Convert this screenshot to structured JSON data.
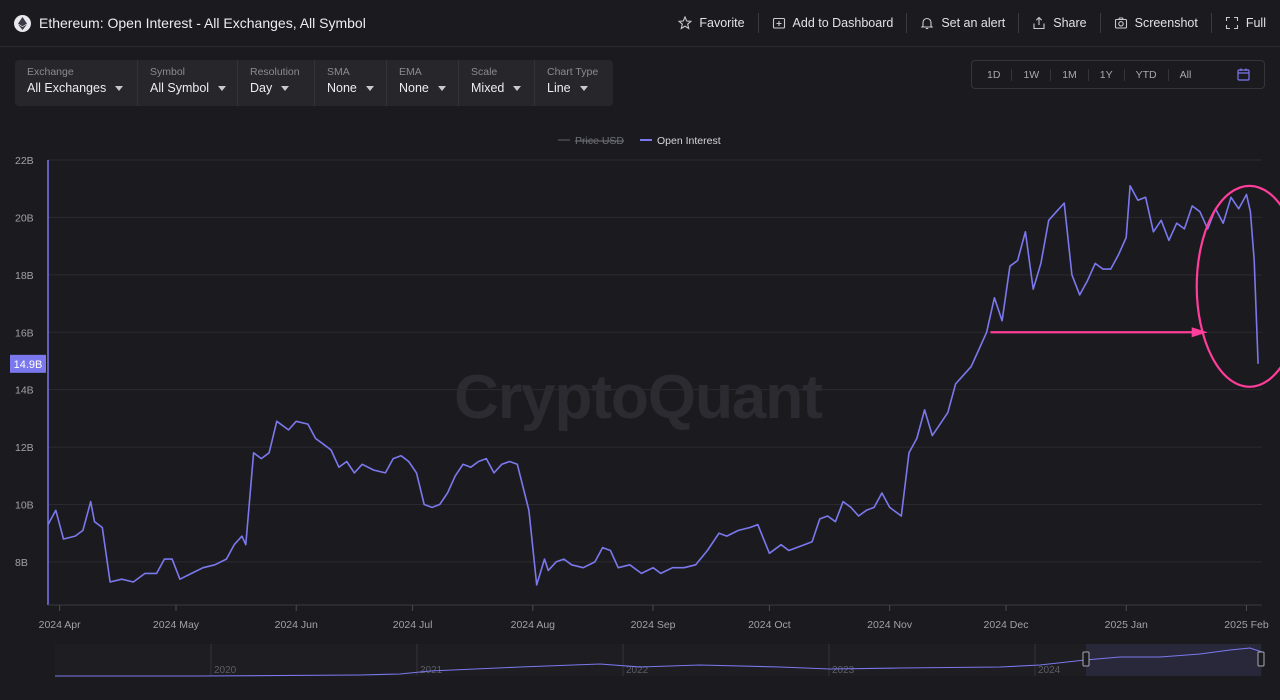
{
  "header": {
    "title": "Ethereum: Open Interest - All Exchanges, All Symbol",
    "actions": {
      "favorite": "Favorite",
      "dashboard": "Add to Dashboard",
      "alert": "Set an alert",
      "share": "Share",
      "screenshot": "Screenshot",
      "full": "Full"
    }
  },
  "controls": [
    {
      "label": "Exchange",
      "value": "All Exchanges"
    },
    {
      "label": "Symbol",
      "value": "All Symbol"
    },
    {
      "label": "Resolution",
      "value": "Day"
    },
    {
      "label": "SMA",
      "value": "None"
    },
    {
      "label": "EMA",
      "value": "None"
    },
    {
      "label": "Scale",
      "value": "Mixed"
    },
    {
      "label": "Chart Type",
      "value": "Line"
    }
  ],
  "ranges": [
    "1D",
    "1W",
    "1M",
    "1Y",
    "YTD",
    "All"
  ],
  "colors": {
    "line": "#7b78ee",
    "annotation": "#ff3d9a",
    "grid": "#2a2a30",
    "axis_text": "#a0a0a8",
    "background": "#1b1b1f",
    "watermark": "#2b2b31"
  },
  "watermark": "CryptoQuant",
  "navigator_years": [
    "2020",
    "2021",
    "2022",
    "2023",
    "2024"
  ],
  "chart_data": {
    "type": "line",
    "legend": [
      {
        "name": "Price USD",
        "hidden": true
      },
      {
        "name": "Open Interest",
        "hidden": false
      }
    ],
    "legend_position": "top-center",
    "y_ticks": [
      "8B",
      "10B",
      "12B",
      "14B",
      "16B",
      "18B",
      "20B",
      "22B"
    ],
    "ylim": [
      6.5,
      22
    ],
    "current_value_label": "14.9B",
    "current_value": 14.9,
    "x_ticks": [
      "2024 Apr",
      "2024 May",
      "2024 Jun",
      "2024 Jul",
      "2024 Aug",
      "2024 Sep",
      "2024 Oct",
      "2024 Nov",
      "2024 Dec",
      "2025 Jan",
      "2025 Feb"
    ],
    "x_tick_dates": [
      "2024-04-01",
      "2024-05-01",
      "2024-06-01",
      "2024-07-01",
      "2024-08-01",
      "2024-09-01",
      "2024-10-01",
      "2024-11-01",
      "2024-12-01",
      "2025-01-01",
      "2025-02-01"
    ],
    "xlim": [
      "2024-03-29",
      "2025-02-05"
    ],
    "grid": true,
    "series": [
      {
        "name": "Open Interest",
        "points": [
          [
            "2024-03-29",
            9.3
          ],
          [
            "2024-03-31",
            9.8
          ],
          [
            "2024-04-02",
            8.8
          ],
          [
            "2024-04-05",
            8.9
          ],
          [
            "2024-04-07",
            9.1
          ],
          [
            "2024-04-09",
            10.1
          ],
          [
            "2024-04-10",
            9.4
          ],
          [
            "2024-04-12",
            9.2
          ],
          [
            "2024-04-14",
            7.3
          ],
          [
            "2024-04-17",
            7.4
          ],
          [
            "2024-04-20",
            7.3
          ],
          [
            "2024-04-23",
            7.6
          ],
          [
            "2024-04-26",
            7.6
          ],
          [
            "2024-04-28",
            8.1
          ],
          [
            "2024-04-30",
            8.1
          ],
          [
            "2024-05-02",
            7.4
          ],
          [
            "2024-05-05",
            7.6
          ],
          [
            "2024-05-08",
            7.8
          ],
          [
            "2024-05-11",
            7.9
          ],
          [
            "2024-05-14",
            8.1
          ],
          [
            "2024-05-16",
            8.6
          ],
          [
            "2024-05-18",
            8.9
          ],
          [
            "2024-05-19",
            8.6
          ],
          [
            "2024-05-21",
            11.8
          ],
          [
            "2024-05-23",
            11.6
          ],
          [
            "2024-05-25",
            11.8
          ],
          [
            "2024-05-27",
            12.9
          ],
          [
            "2024-05-30",
            12.6
          ],
          [
            "2024-06-01",
            12.9
          ],
          [
            "2024-06-04",
            12.8
          ],
          [
            "2024-06-06",
            12.3
          ],
          [
            "2024-06-08",
            12.1
          ],
          [
            "2024-06-10",
            11.9
          ],
          [
            "2024-06-12",
            11.3
          ],
          [
            "2024-06-14",
            11.5
          ],
          [
            "2024-06-16",
            11.1
          ],
          [
            "2024-06-18",
            11.4
          ],
          [
            "2024-06-21",
            11.2
          ],
          [
            "2024-06-24",
            11.1
          ],
          [
            "2024-06-26",
            11.6
          ],
          [
            "2024-06-28",
            11.7
          ],
          [
            "2024-06-30",
            11.5
          ],
          [
            "2024-07-02",
            11.1
          ],
          [
            "2024-07-04",
            10.0
          ],
          [
            "2024-07-06",
            9.9
          ],
          [
            "2024-07-08",
            10.0
          ],
          [
            "2024-07-10",
            10.4
          ],
          [
            "2024-07-12",
            11.0
          ],
          [
            "2024-07-14",
            11.4
          ],
          [
            "2024-07-16",
            11.3
          ],
          [
            "2024-07-18",
            11.5
          ],
          [
            "2024-07-20",
            11.6
          ],
          [
            "2024-07-22",
            11.1
          ],
          [
            "2024-07-24",
            11.4
          ],
          [
            "2024-07-26",
            11.5
          ],
          [
            "2024-07-28",
            11.4
          ],
          [
            "2024-07-31",
            9.8
          ],
          [
            "2024-08-02",
            7.2
          ],
          [
            "2024-08-04",
            8.1
          ],
          [
            "2024-08-05",
            7.7
          ],
          [
            "2024-08-07",
            8.0
          ],
          [
            "2024-08-09",
            8.1
          ],
          [
            "2024-08-11",
            7.9
          ],
          [
            "2024-08-14",
            7.8
          ],
          [
            "2024-08-17",
            8.0
          ],
          [
            "2024-08-19",
            8.5
          ],
          [
            "2024-08-21",
            8.4
          ],
          [
            "2024-08-23",
            7.8
          ],
          [
            "2024-08-26",
            7.9
          ],
          [
            "2024-08-29",
            7.6
          ],
          [
            "2024-09-01",
            7.8
          ],
          [
            "2024-09-03",
            7.6
          ],
          [
            "2024-09-06",
            7.8
          ],
          [
            "2024-09-09",
            7.8
          ],
          [
            "2024-09-12",
            7.9
          ],
          [
            "2024-09-15",
            8.4
          ],
          [
            "2024-09-18",
            9.0
          ],
          [
            "2024-09-20",
            8.9
          ],
          [
            "2024-09-23",
            9.1
          ],
          [
            "2024-09-26",
            9.2
          ],
          [
            "2024-09-28",
            9.3
          ],
          [
            "2024-10-01",
            8.3
          ],
          [
            "2024-10-04",
            8.6
          ],
          [
            "2024-10-06",
            8.4
          ],
          [
            "2024-10-08",
            8.5
          ],
          [
            "2024-10-10",
            8.6
          ],
          [
            "2024-10-12",
            8.7
          ],
          [
            "2024-10-14",
            9.5
          ],
          [
            "2024-10-16",
            9.6
          ],
          [
            "2024-10-18",
            9.4
          ],
          [
            "2024-10-20",
            10.1
          ],
          [
            "2024-10-22",
            9.9
          ],
          [
            "2024-10-24",
            9.6
          ],
          [
            "2024-10-26",
            9.8
          ],
          [
            "2024-10-28",
            9.9
          ],
          [
            "2024-10-30",
            10.4
          ],
          [
            "2024-11-01",
            9.9
          ],
          [
            "2024-11-04",
            9.6
          ],
          [
            "2024-11-06",
            11.8
          ],
          [
            "2024-11-08",
            12.3
          ],
          [
            "2024-11-10",
            13.3
          ],
          [
            "2024-11-12",
            12.4
          ],
          [
            "2024-11-14",
            12.8
          ],
          [
            "2024-11-16",
            13.2
          ],
          [
            "2024-11-18",
            14.2
          ],
          [
            "2024-11-20",
            14.5
          ],
          [
            "2024-11-22",
            14.8
          ],
          [
            "2024-11-24",
            15.4
          ],
          [
            "2024-11-26",
            16.0
          ],
          [
            "2024-11-28",
            17.2
          ],
          [
            "2024-11-30",
            16.4
          ],
          [
            "2024-12-02",
            18.3
          ],
          [
            "2024-12-04",
            18.5
          ],
          [
            "2024-12-06",
            19.5
          ],
          [
            "2024-12-08",
            17.5
          ],
          [
            "2024-12-10",
            18.4
          ],
          [
            "2024-12-12",
            19.9
          ],
          [
            "2024-12-14",
            20.2
          ],
          [
            "2024-12-16",
            20.5
          ],
          [
            "2024-12-18",
            18.0
          ],
          [
            "2024-12-20",
            17.3
          ],
          [
            "2024-12-22",
            17.8
          ],
          [
            "2024-12-24",
            18.4
          ],
          [
            "2024-12-26",
            18.2
          ],
          [
            "2024-12-28",
            18.2
          ],
          [
            "2024-12-30",
            18.7
          ],
          [
            "2025-01-01",
            19.3
          ],
          [
            "2025-01-02",
            21.1
          ],
          [
            "2025-01-04",
            20.6
          ],
          [
            "2025-01-06",
            20.7
          ],
          [
            "2025-01-08",
            19.5
          ],
          [
            "2025-01-10",
            19.9
          ],
          [
            "2025-01-12",
            19.2
          ],
          [
            "2025-01-14",
            19.8
          ],
          [
            "2025-01-16",
            19.6
          ],
          [
            "2025-01-18",
            20.4
          ],
          [
            "2025-01-20",
            20.2
          ],
          [
            "2025-01-22",
            19.6
          ],
          [
            "2025-01-24",
            20.3
          ],
          [
            "2025-01-26",
            19.8
          ],
          [
            "2025-01-28",
            20.7
          ],
          [
            "2025-01-30",
            20.3
          ],
          [
            "2025-02-01",
            20.8
          ],
          [
            "2025-02-02",
            20.2
          ],
          [
            "2025-02-03",
            18.5
          ],
          [
            "2025-02-04",
            14.9
          ]
        ]
      }
    ],
    "annotations": [
      {
        "type": "arrow",
        "from": [
          "2024-11-27",
          16.0
        ],
        "to": [
          "2025-01-22",
          16.0
        ]
      },
      {
        "type": "ellipse",
        "center": [
          "2025-02-01",
          17.6
        ],
        "radii_x_days": 1.6,
        "radii_y": 3.5
      }
    ]
  }
}
